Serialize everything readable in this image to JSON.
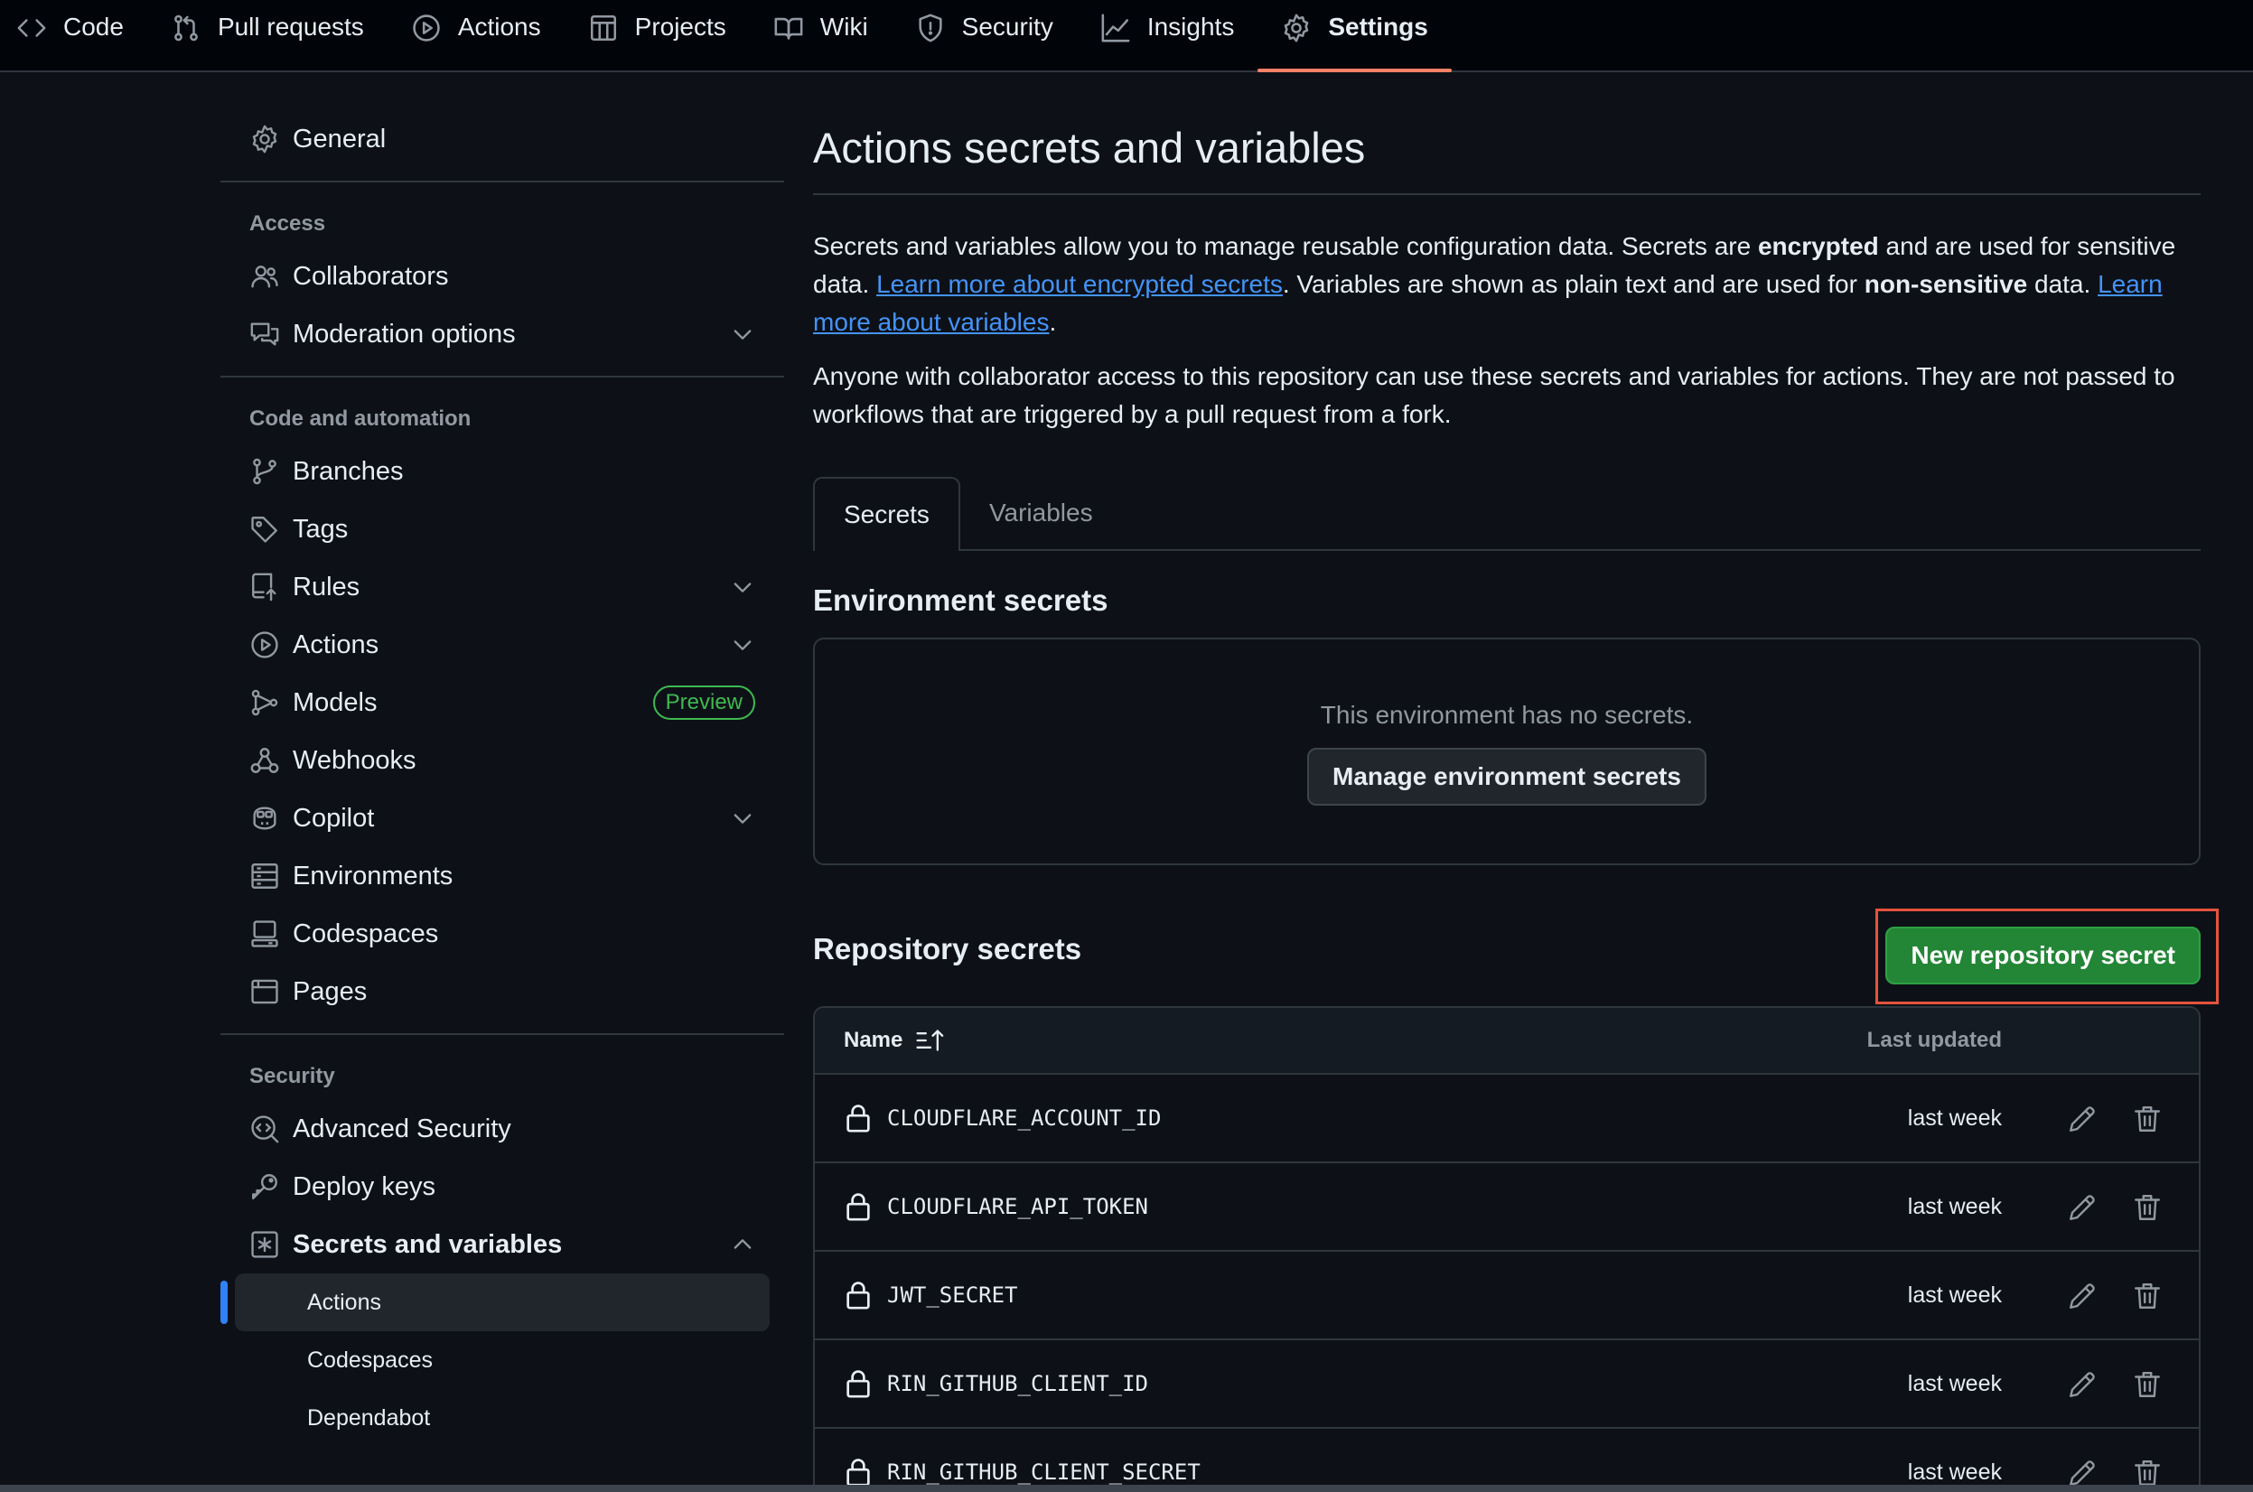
{
  "nav": {
    "tabs": [
      {
        "label": "Code",
        "icon": "code-icon"
      },
      {
        "label": "Pull requests",
        "icon": "git-pull-request-icon"
      },
      {
        "label": "Actions",
        "icon": "play-circle-icon"
      },
      {
        "label": "Projects",
        "icon": "table-icon"
      },
      {
        "label": "Wiki",
        "icon": "book-icon"
      },
      {
        "label": "Security",
        "icon": "shield-icon"
      },
      {
        "label": "Insights",
        "icon": "graph-icon"
      },
      {
        "label": "Settings",
        "icon": "gear-icon"
      }
    ],
    "active": "Settings"
  },
  "sidebar": {
    "general": "General",
    "access_heading": "Access",
    "collaborators": "Collaborators",
    "moderation": "Moderation options",
    "code_heading": "Code and automation",
    "branches": "Branches",
    "tags": "Tags",
    "rules": "Rules",
    "actions": "Actions",
    "models": "Models",
    "models_badge": "Preview",
    "webhooks": "Webhooks",
    "copilot": "Copilot",
    "environments": "Environments",
    "codespaces": "Codespaces",
    "pages": "Pages",
    "security_heading": "Security",
    "advanced_security": "Advanced Security",
    "deploy_keys": "Deploy keys",
    "secrets_variables": "Secrets and variables",
    "sub": {
      "actions": "Actions",
      "codespaces": "Codespaces",
      "dependabot": "Dependabot"
    }
  },
  "main": {
    "title": "Actions secrets and variables",
    "desc1_a": "Secrets and variables allow you to manage reusable configuration data. Secrets are ",
    "desc1_b": "encrypted",
    "desc1_c": " and are used for sensitive data. ",
    "desc1_link1": "Learn more about encrypted secrets",
    "desc1_d": ". Variables are shown as plain text and are used for ",
    "desc1_e": "non-sensitive",
    "desc1_f": " data. ",
    "desc1_link2": "Learn more about variables",
    "desc1_g": ".",
    "desc2": "Anyone with collaborator access to this repository can use these secrets and variables for actions. They are not passed to workflows that are triggered by a pull request from a fork.",
    "tabs": {
      "secrets": "Secrets",
      "variables": "Variables"
    },
    "env_title": "Environment secrets",
    "env_empty": "This environment has no secrets.",
    "env_button": "Manage environment secrets",
    "repo_title": "Repository secrets",
    "new_secret_button": "New repository secret",
    "table": {
      "col_name": "Name",
      "col_updated": "Last updated",
      "rows": [
        {
          "name": "CLOUDFLARE_ACCOUNT_ID",
          "updated": "last week"
        },
        {
          "name": "CLOUDFLARE_API_TOKEN",
          "updated": "last week"
        },
        {
          "name": "JWT_SECRET",
          "updated": "last week"
        },
        {
          "name": "RIN_GITHUB_CLIENT_ID",
          "updated": "last week"
        },
        {
          "name": "RIN_GITHUB_CLIENT_SECRET",
          "updated": "last week"
        }
      ]
    }
  },
  "colors": {
    "background": "#0d1117",
    "accent_tab": "#f78166",
    "link": "#4493f8",
    "primary_button": "#238636",
    "preview_badge": "#3fb950",
    "highlight_box": "#e5533d",
    "active_indicator": "#2f81f7"
  }
}
